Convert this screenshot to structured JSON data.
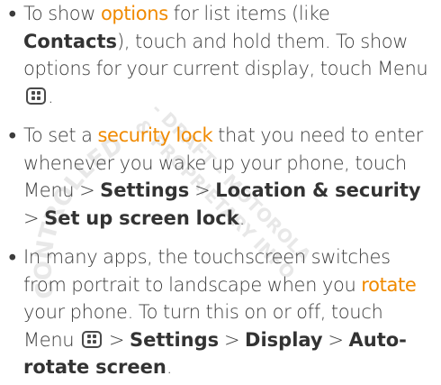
{
  "watermark": {
    "arc_text": "CONTROLLED",
    "line1": "- DRAFT - MOTOROLA",
    "line2": "& PROPRIETARY INFO"
  },
  "items": [
    {
      "p1": "To show ",
      "kw": "options",
      "p2": " for list items (like ",
      "b1": "Contacts",
      "p3": "), touch and hold them. To show options for your current display, touch Menu ",
      "p4": "."
    },
    {
      "p1": "To set a ",
      "kw": "security lock",
      "p2": " that you need to enter whenever you wake up your phone, touch Menu  > ",
      "b1": "Settings",
      "sep1": " > ",
      "b2": "Location & security",
      "sep2": " > ",
      "b3": "Set up screen lock",
      "p3": "."
    },
    {
      "p1": "In many apps, the touchscreen switches from portrait to landscape when you ",
      "kw": "rotate",
      "p2": " your phone. To turn this on or off, touch Menu ",
      "sep0": " > ",
      "b1": "Settings",
      "sep1": " > ",
      "b2": "Display",
      "sep2": " > ",
      "b3": "Auto-rotate screen",
      "p3": "."
    }
  ]
}
